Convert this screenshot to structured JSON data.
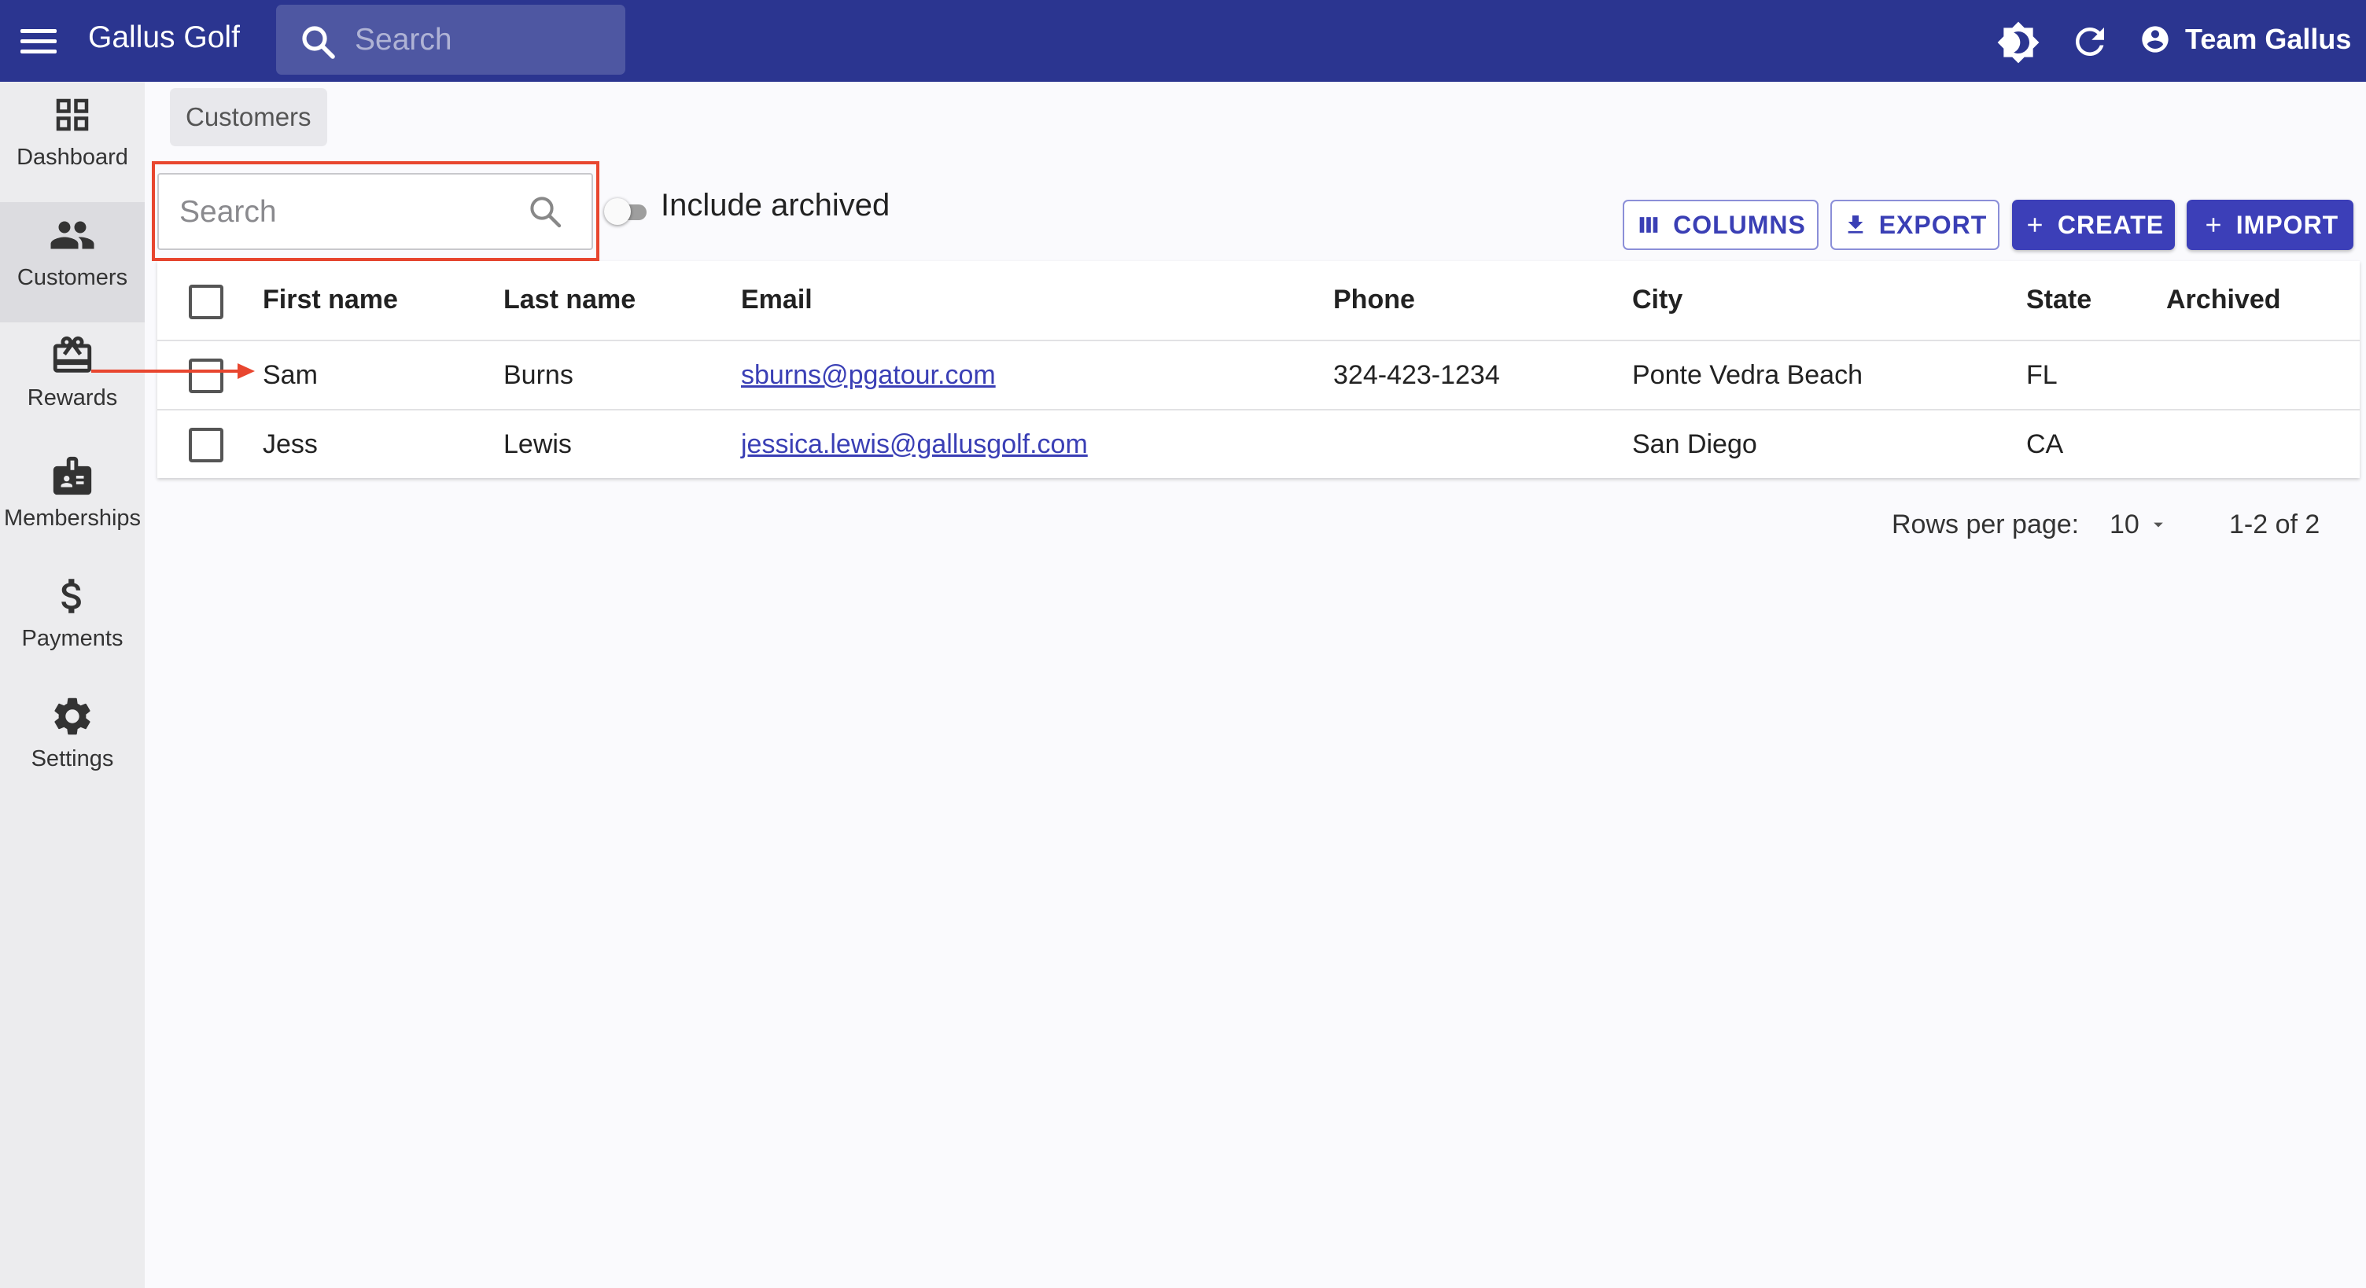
{
  "app": {
    "title": "Gallus Golf",
    "search_placeholder": "Search",
    "account_label": "Team Gallus",
    "bar_color": "#2b3590"
  },
  "sidebar": {
    "items": [
      {
        "label": "Dashboard",
        "icon": "dashboard-icon"
      },
      {
        "label": "Customers",
        "icon": "people-icon",
        "active": true
      },
      {
        "label": "Rewards",
        "icon": "gift-card-icon"
      },
      {
        "label": "Memberships",
        "icon": "badge-icon"
      },
      {
        "label": "Payments",
        "icon": "dollar-icon"
      },
      {
        "label": "Settings",
        "icon": "gear-icon"
      }
    ]
  },
  "breadcrumb": "Customers",
  "filters": {
    "search_placeholder": "Search",
    "include_archived_label": "Include archived",
    "include_archived": false
  },
  "toolbar": {
    "columns_label": "COLUMNS",
    "export_label": "EXPORT",
    "create_label": "CREATE",
    "import_label": "IMPORT",
    "accent_color": "#3c3fb8"
  },
  "table": {
    "columns": [
      "First name",
      "Last name",
      "Email",
      "Phone",
      "City",
      "State",
      "Archived"
    ],
    "rows": [
      {
        "first": "Sam",
        "last": "Burns",
        "email": "sburns@pgatour.com",
        "phone": "324-423-1234",
        "city": "Ponte Vedra Beach",
        "state": "FL",
        "archived": ""
      },
      {
        "first": "Jess",
        "last": "Lewis",
        "email": "jessica.lewis@gallusgolf.com",
        "phone": "",
        "city": "San Diego",
        "state": "CA",
        "archived": ""
      }
    ]
  },
  "pagination": {
    "rows_per_page_label": "Rows per page:",
    "rows_per_page": "10",
    "range": "1-2 of 2"
  },
  "annotation": {
    "highlight_color": "#e8462f"
  }
}
